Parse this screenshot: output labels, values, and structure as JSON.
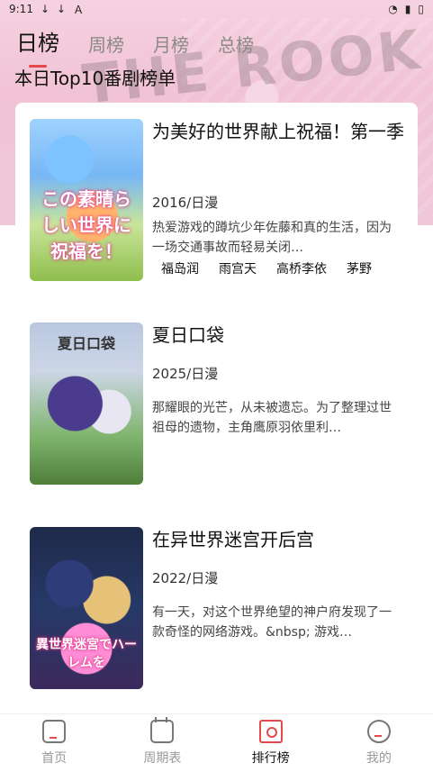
{
  "status": {
    "time": "9:11",
    "left_icons": [
      "download-icon",
      "download-icon",
      "a-icon"
    ],
    "right_icons": [
      "wifi-icon",
      "signal-icon",
      "battery-icon"
    ]
  },
  "tabs": [
    {
      "label": "日榜",
      "active": true
    },
    {
      "label": "周榜",
      "active": false
    },
    {
      "label": "月榜",
      "active": false
    },
    {
      "label": "总榜",
      "active": false
    }
  ],
  "subtitle": "本日Top10番剧榜单",
  "items": [
    {
      "title": "为美好的世界献上祝福！第一季",
      "year": "2016/日漫",
      "desc": "热爱游戏的蹲坑少年佐藤和真的生活，因为一场交通事故而轻易关闭…",
      "cast": [
        "福岛润",
        "雨宫天",
        "高桥李依",
        "茅野"
      ],
      "poster_text": "この素晴らしい世界に祝福を！"
    },
    {
      "title": "夏日口袋",
      "year": "2025/日漫",
      "desc": "那耀眼的光芒，从未被遗忘。为了整理过世祖母的遗物，主角鹰原羽依里利…",
      "poster_text": "夏日口袋"
    },
    {
      "title": "在异世界迷宫开后宫",
      "year": "2022/日漫",
      "desc": "有一天，对这个世界绝望的神户府发现了一款奇怪的网络游戏。&nbsp; 游戏…",
      "poster_text": "異世界迷宮でハーレムを"
    }
  ],
  "bottom_nav": [
    {
      "label": "首页",
      "active": false,
      "icon": "home-icon"
    },
    {
      "label": "周期表",
      "active": false,
      "icon": "calendar-icon"
    },
    {
      "label": "排行榜",
      "active": true,
      "icon": "ranking-icon"
    },
    {
      "label": "我的",
      "active": false,
      "icon": "profile-icon"
    }
  ],
  "colors": {
    "accent": "#e5484d",
    "hero_bg": "#f1c3d5"
  }
}
